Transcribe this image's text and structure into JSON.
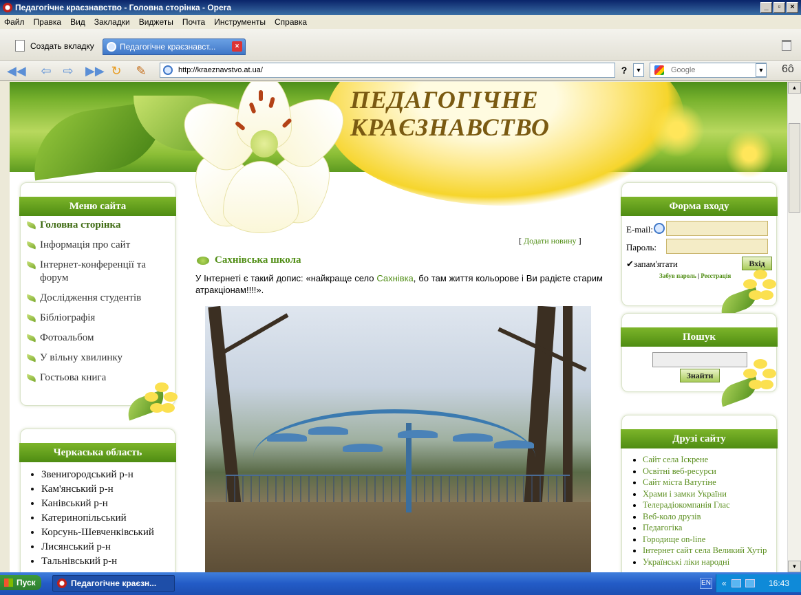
{
  "window": {
    "title": "Педагогічне краєзнавство - Головна сторінка - Opera"
  },
  "menubar": [
    "Файл",
    "Правка",
    "Вид",
    "Закладки",
    "Виджеты",
    "Почта",
    "Инструменты",
    "Справка"
  ],
  "tabs": {
    "new_tab": "Создать вкладку",
    "active_tab": "Педагогічне краєзнавст..."
  },
  "navbar": {
    "url": "http://kraeznavstvo.at.ua/",
    "search_engine": "Google",
    "help_label": "?"
  },
  "site": {
    "title_line1": "ПЕДАГОГІЧНЕ",
    "title_line2": "КРАЄЗНАВСТВО"
  },
  "menu_box": {
    "title": "Меню сайта",
    "items": [
      "Головна сторінка",
      "Інформація про сайт",
      "Інтернет-конференції та форум",
      "Дослідження студентів",
      "Бібліографія",
      "Фотоальбом",
      "У вільну хвилинку",
      "Гостьова книга"
    ]
  },
  "region_box": {
    "title": "Черкаська область",
    "items": [
      "Звенигородський р-н",
      "Кам'янський р-н",
      "Канівський р-н",
      "Катеринопільський",
      "Корсунь-Шевченківський",
      "Лисянський р-н",
      "Тальнівський р-н"
    ]
  },
  "content": {
    "add_news_open": "[",
    "add_news": "Додати новину",
    "add_news_close": "]",
    "post_title": "Сахнівська школа",
    "post_text_before": "У Інтернеті є такий допис: «найкраще село ",
    "post_link": "Сахнівка",
    "post_text_after": ", бо там життя кольорове і Ви радієте старим атракціонам!!!!»."
  },
  "login_box": {
    "title": "Форма входу",
    "email_label": "E-mail:",
    "password_label": "Пароль:",
    "remember_label": "запам'ятати",
    "remember_checked": true,
    "login_button": "Вхід",
    "forgot_link": "Забув пароль",
    "separator": "|",
    "register_link": "Реєстрація"
  },
  "search_box": {
    "title": "Пошук",
    "button": "Знайти"
  },
  "friends_box": {
    "title": "Друзі сайту",
    "items": [
      "Сайт села Іскрене",
      "Освітні веб-ресурси",
      "Сайт міста Ватутіне",
      "Храми і замки України",
      "Телерадіокомпанія Глас",
      "Веб-коло друзів",
      "Педагогіка",
      "Городище on-line",
      "Інтернет сайт села Великий Хутір",
      "Українські ліки народні"
    ]
  },
  "taskbar": {
    "start": "Пуск",
    "task": "Педагогічне краєзн...",
    "lang": "EN",
    "clock": "16:43",
    "tray_arrows": "«"
  },
  "colors": {
    "accent_green": "#4e8c12",
    "header_green": "#7db52a",
    "link_green": "#5b8f1f"
  }
}
